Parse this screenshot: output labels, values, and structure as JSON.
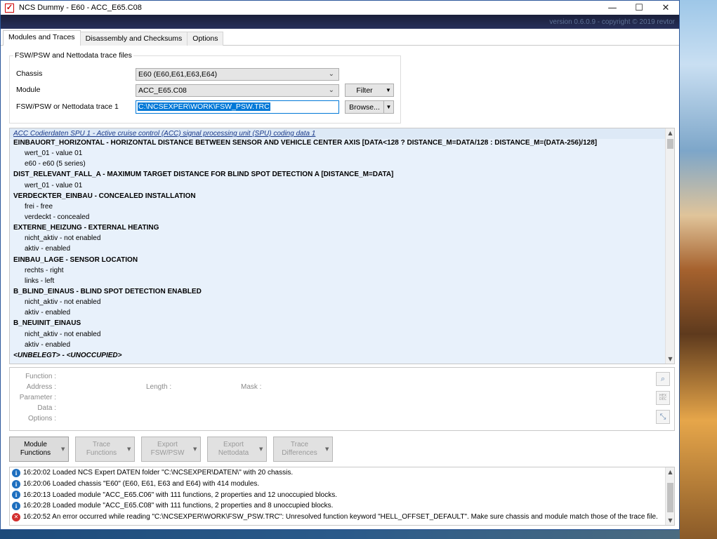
{
  "window": {
    "title": "NCS Dummy - E60 - ACC_E65.C08",
    "version": "version 0.6.0.9 - copyright © 2019 revtor",
    "controls": {
      "minimize": "—",
      "maximize": "☐",
      "close": "✕"
    }
  },
  "tabs": [
    {
      "label": "Modules and Traces",
      "active": true
    },
    {
      "label": "Disassembly and Checksums",
      "active": false
    },
    {
      "label": "Options",
      "active": false
    }
  ],
  "trace_files": {
    "group_title": "FSW/PSW and Nettodata trace files",
    "chassis_label": "Chassis",
    "chassis_value": "E60  (E60,E61,E63,E64)",
    "module_label": "Module",
    "module_value": "ACC_E65.C08",
    "trace_label": "FSW/PSW or Nettodata trace 1",
    "trace_value": "C:\\NCSEXPER\\WORK\\FSW_PSW.TRC",
    "filter_label": "Filter",
    "browse_label": "Browse..."
  },
  "list": {
    "header": "ACC Codierdaten SPU 1  -  Active cruise control (ACC) signal processing unit (SPU) coding data 1",
    "rows": [
      {
        "type": "fn",
        "text": "EINBAUORT_HORIZONTAL  -  HORIZONTAL DISTANCE BETWEEN SENSOR AND VEHICLE CENTER AXIS [DATA<128 ? DISTANCE_M=DATA/128 : DISTANCE_M=(DATA-256)/128]"
      },
      {
        "type": "opt",
        "text": "wert_01  -  value 01"
      },
      {
        "type": "opt",
        "text": "e60  -  e60 (5 series)"
      },
      {
        "type": "fn",
        "text": "DIST_RELEVANT_FALL_A  -  MAXIMUM TARGET DISTANCE FOR BLIND SPOT DETECTION A [DISTANCE_M=DATA]"
      },
      {
        "type": "opt",
        "text": "wert_01  -  value 01"
      },
      {
        "type": "fn",
        "text": "VERDECKTER_EINBAU  -  CONCEALED INSTALLATION"
      },
      {
        "type": "opt",
        "text": "frei  -  free"
      },
      {
        "type": "opt",
        "text": "verdeckt  -  concealed"
      },
      {
        "type": "fn",
        "text": "EXTERNE_HEIZUNG  -  EXTERNAL HEATING"
      },
      {
        "type": "opt",
        "text": "nicht_aktiv  -  not enabled"
      },
      {
        "type": "opt",
        "text": "aktiv  -  enabled"
      },
      {
        "type": "fn",
        "text": "EINBAU_LAGE  -  SENSOR LOCATION"
      },
      {
        "type": "opt",
        "text": "rechts  -  right"
      },
      {
        "type": "opt",
        "text": "links  -  left"
      },
      {
        "type": "fn",
        "text": "B_BLIND_EINAUS  -  BLIND SPOT DETECTION ENABLED"
      },
      {
        "type": "opt",
        "text": "nicht_aktiv  -  not enabled"
      },
      {
        "type": "opt",
        "text": "aktiv  -  enabled"
      },
      {
        "type": "fn",
        "text": "B_NEUINIT_EINAUS"
      },
      {
        "type": "opt",
        "text": "nicht_aktiv  -  not enabled"
      },
      {
        "type": "opt",
        "text": "aktiv  -  enabled"
      },
      {
        "type": "unocc",
        "text": "<UNBELEGT>  -  <UNOCCUPIED>"
      }
    ]
  },
  "details": {
    "function": "Function :",
    "address": "Address :",
    "parameter": "Parameter :",
    "data": "Data :",
    "options": "Options :",
    "length": "Length :",
    "mask": "Mask :",
    "hex_dec": "HEX DEC"
  },
  "actions": [
    {
      "line1": "Module",
      "line2": "Functions",
      "enabled": true
    },
    {
      "line1": "Trace",
      "line2": "Functions",
      "enabled": false
    },
    {
      "line1": "Export",
      "line2": "FSW/PSW",
      "enabled": false
    },
    {
      "line1": "Export",
      "line2": "Nettodata",
      "enabled": false
    },
    {
      "line1": "Trace",
      "line2": "Differences",
      "enabled": false
    }
  ],
  "log": [
    {
      "level": "info",
      "text": "16:20:02  Loaded NCS Expert DATEN folder \"C:\\NCSEXPER\\DATEN\\\" with 20 chassis."
    },
    {
      "level": "info",
      "text": "16:20:06  Loaded chassis \"E60\" (E60, E61, E63 and E64) with 414 modules."
    },
    {
      "level": "info",
      "text": "16:20:13  Loaded module \"ACC_E65.C06\" with 111 functions, 2 properties and 12 unoccupied blocks."
    },
    {
      "level": "info",
      "text": "16:20:28  Loaded module \"ACC_E65.C08\" with 111 functions, 2 properties and 8 unoccupied blocks."
    },
    {
      "level": "error",
      "text": "16:20:52  An error occurred while reading \"C:\\NCSEXPER\\WORK\\FSW_PSW.TRC\": Unresolved function keyword \"HELL_OFFSET_DEFAULT\". Make sure chassis and module match those of the trace file."
    }
  ]
}
